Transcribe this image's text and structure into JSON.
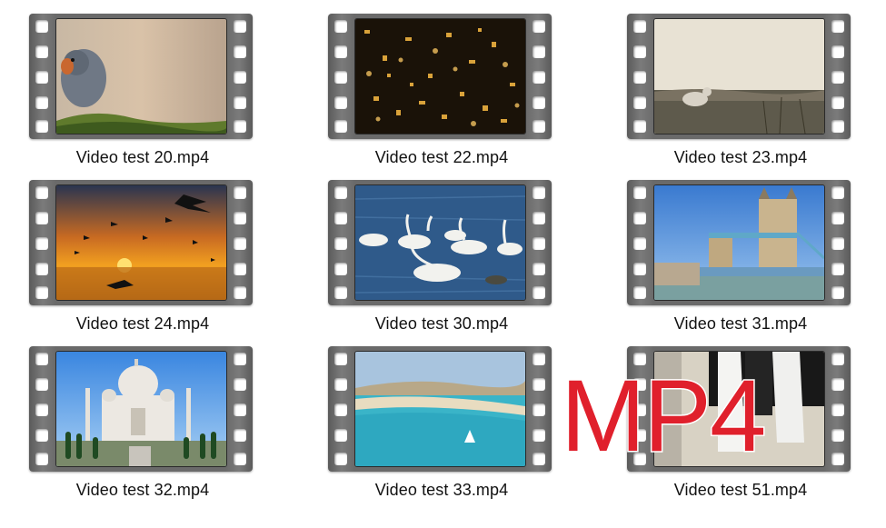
{
  "tiles": [
    {
      "file": "Video test 20.mp4",
      "thumbnail": "robin-bird-on-moss"
    },
    {
      "file": "Video test 22.mp4",
      "thumbnail": "gold-confetti"
    },
    {
      "file": "Video test 23.mp4",
      "thumbnail": "dog-running-in-field"
    },
    {
      "file": "Video test 24.mp4",
      "thumbnail": "sunset-with-seagulls"
    },
    {
      "file": "Video test 30.mp4",
      "thumbnail": "swans-on-water"
    },
    {
      "file": "Video test 31.mp4",
      "thumbnail": "tower-bridge"
    },
    {
      "file": "Video test 32.mp4",
      "thumbnail": "taj-mahal"
    },
    {
      "file": "Video test 33.mp4",
      "thumbnail": "turquoise-beach"
    },
    {
      "file": "Video test 51.mp4",
      "thumbnail": "cat-paws"
    }
  ],
  "overlay_text": "MP4",
  "colors": {
    "overlay": "#e0202c",
    "film": "#6a6a6a",
    "caption": "#111111"
  }
}
